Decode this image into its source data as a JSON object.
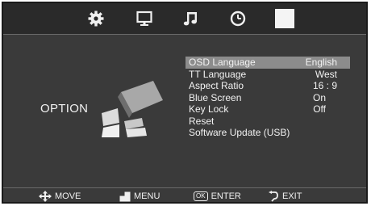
{
  "tabs": [
    {
      "icon": "gear-icon"
    },
    {
      "icon": "monitor-icon"
    },
    {
      "icon": "music-note-icon"
    },
    {
      "icon": "clock-icon"
    },
    {
      "icon": "option-tab-icon",
      "selected": true
    }
  ],
  "page_label": "OPTION",
  "menu": {
    "items": [
      {
        "label": "OSD  Language",
        "value": "English",
        "highlighted": true
      },
      {
        "label": "TT Language",
        "value": "West"
      },
      {
        "label": "Aspect  Ratio",
        "value": "16 : 9"
      },
      {
        "label": "Blue  Screen",
        "value": "On"
      },
      {
        "label": "Key  Lock",
        "value": "Off"
      },
      {
        "label": "Reset",
        "value": ""
      },
      {
        "label": "Software  Update (USB)",
        "value": ""
      }
    ]
  },
  "footer": {
    "move": "MOVE",
    "menu": "MENU",
    "ok_key": "OK",
    "enter": "ENTER",
    "exit": "EXIT"
  },
  "colors": {
    "background": "#3a3a3a",
    "highlight": "#8c8c8c",
    "text": "#f2f2f2"
  }
}
